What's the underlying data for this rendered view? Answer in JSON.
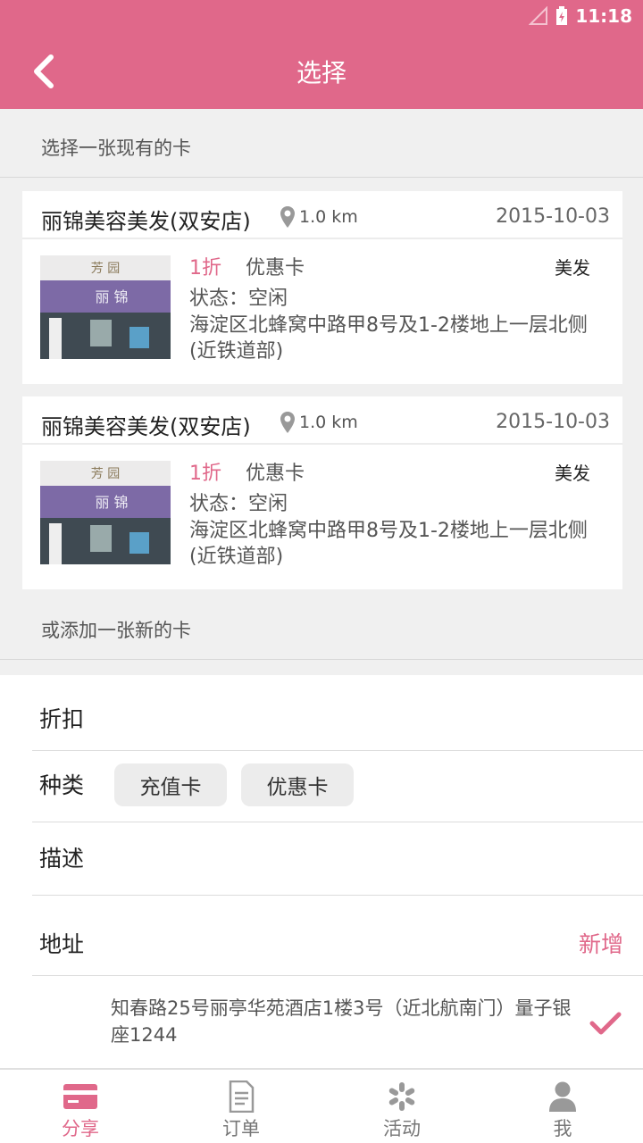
{
  "status_bar": {
    "time": "11:18"
  },
  "header": {
    "title": "选择"
  },
  "existing_section": {
    "label": "选择一张现有的卡"
  },
  "cards": [
    {
      "store_name": "丽锦美容美发(双安店)",
      "distance": "1.0 km",
      "date": "2015-10-03",
      "discount": "1折",
      "card_type": "优惠卡",
      "category": "美发",
      "status": "状态：空闲",
      "address": "海淀区北蜂窝中路甲8号及1-2楼地上一层北侧(近铁道部)",
      "thumb_sign_top": "芳 园",
      "thumb_sign_main": "丽 锦"
    },
    {
      "store_name": "丽锦美容美发(双安店)",
      "distance": "1.0 km",
      "date": "2015-10-03",
      "discount": "1折",
      "card_type": "优惠卡",
      "category": "美发",
      "status": "状态：空闲",
      "address": "海淀区北蜂窝中路甲8号及1-2楼地上一层北侧(近铁道部)",
      "thumb_sign_top": "芳 园",
      "thumb_sign_main": "丽 锦"
    }
  ],
  "new_section": {
    "label": "或添加一张新的卡"
  },
  "form": {
    "discount_label": "折扣",
    "type_label": "种类",
    "type_options": [
      "充值卡",
      "优惠卡"
    ],
    "description_label": "描述",
    "address_label": "地址",
    "add_label": "新增",
    "saved_address": "知春路25号丽亭华苑酒店1楼3号（近北航南门）量子银座1244"
  },
  "tabs": [
    {
      "label": "分享",
      "icon": "card-icon",
      "active": true
    },
    {
      "label": "订单",
      "icon": "document-icon",
      "active": false
    },
    {
      "label": "活动",
      "icon": "sparkle-icon",
      "active": false
    },
    {
      "label": "我",
      "icon": "person-icon",
      "active": false
    }
  ],
  "colors": {
    "accent": "#e0688a",
    "background": "#f0f0f0"
  }
}
